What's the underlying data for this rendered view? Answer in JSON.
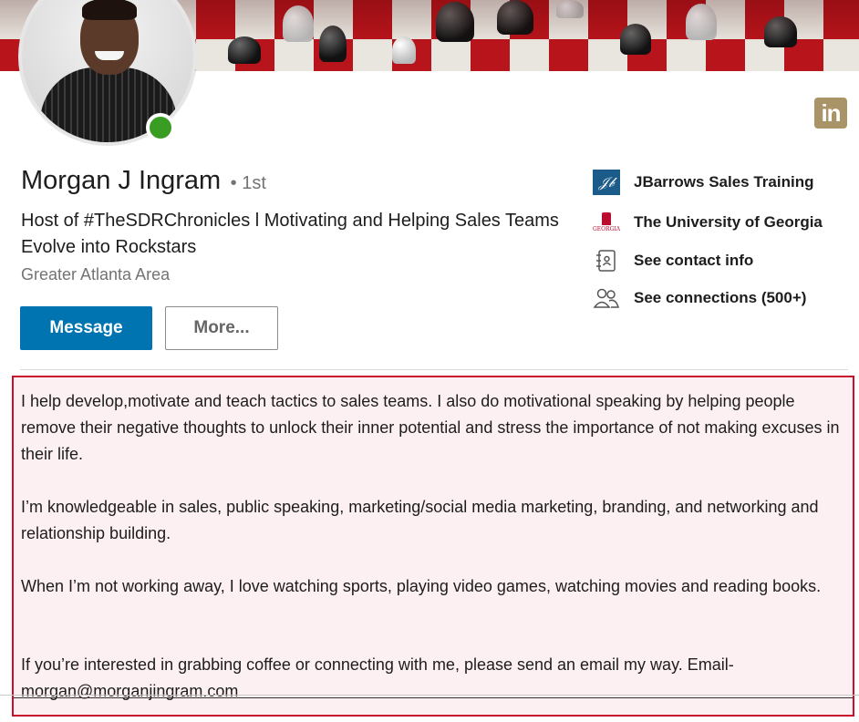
{
  "profile": {
    "name": "Morgan J Ingram",
    "degree": "• 1st",
    "headline": "Host of #TheSDRChronicles l Motivating and Helping Sales Teams Evolve into Rockstars",
    "location": "Greater Atlanta Area",
    "online": true
  },
  "actions": {
    "message_label": "Message",
    "more_label": "More..."
  },
  "sidebar": {
    "items": [
      {
        "label": "JBarrows Sales Training",
        "icon": "jbarrows-logo-icon"
      },
      {
        "label": "The University of Georgia",
        "icon": "uga-logo-icon"
      },
      {
        "label": "See contact info",
        "icon": "contact-card-icon"
      },
      {
        "label": "See connections (500+)",
        "icon": "connections-icon"
      }
    ],
    "logos": {
      "jb_mark": "𝒥𝒷",
      "uga_text": "GEORGIA"
    }
  },
  "linkedin_badge": "in",
  "summary": {
    "paragraphs": [
      "I help develop,motivate and teach tactics to sales teams. I also do motivational speaking by helping people remove their negative thoughts to unlock their inner potential and stress the importance of not making excuses in their life.",
      "I’m knowledgeable in sales, public speaking, marketing/social media marketing, branding, and networking and relationship building.",
      "When I’m not working away, I love watching sports, playing video games, watching movies and reading books.",
      "If you’re interested in grabbing coffee or connecting with me, please send an email my way. Email-morgan@morganjingram.com"
    ]
  },
  "colors": {
    "primary_button": "#0073b1",
    "online_status": "#3a9d23",
    "highlight_border": "#c8102e",
    "highlight_fill": "#fcf0f2",
    "linkedin_badge": "#a89466"
  }
}
